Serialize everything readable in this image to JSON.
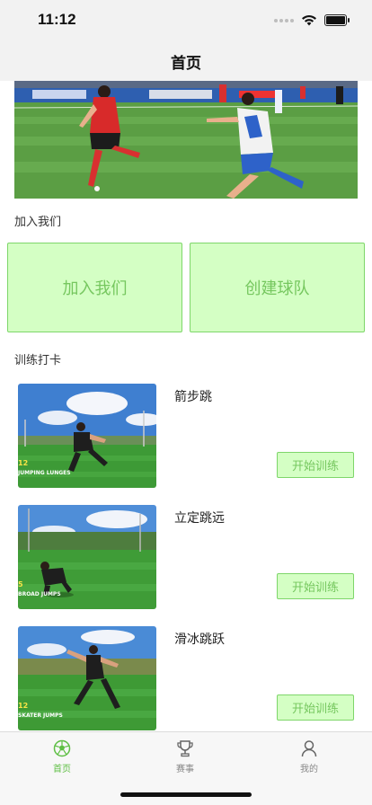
{
  "status": {
    "time": "11:12"
  },
  "nav": {
    "title": "首页"
  },
  "sections": {
    "join": "加入我们",
    "training": "训练打卡"
  },
  "actions": {
    "join_us": "加入我们",
    "create_team": "创建球队"
  },
  "training": [
    {
      "title": "箭步跳",
      "button": "开始训练",
      "caption_num": "12",
      "caption": "JUMPING LUNGES"
    },
    {
      "title": "立定跳远",
      "button": "开始训练",
      "caption_num": "5",
      "caption": "BROAD JUMPS"
    },
    {
      "title": "滑冰跳跃",
      "button": "开始训练",
      "caption_num": "12",
      "caption": "SKATER JUMPS"
    }
  ],
  "tabs": [
    {
      "label": "首页",
      "icon": "soccer-ball-icon",
      "active": true
    },
    {
      "label": "赛事",
      "icon": "trophy-icon",
      "active": false
    },
    {
      "label": "我的",
      "icon": "user-icon",
      "active": false
    }
  ],
  "colors": {
    "accent": "#5fbf45",
    "button_bg": "#d4ffc4",
    "button_border": "#7ed66a",
    "button_text": "#76c75f"
  }
}
